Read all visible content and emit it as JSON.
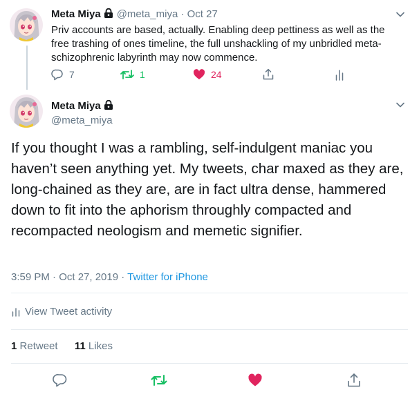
{
  "parent_tweet": {
    "name": "Meta Miya",
    "handle": "@meta_miya",
    "separator": "·",
    "date": "Oct 27",
    "text": "Priv accounts are based, actually. Enabling deep pettiness as well as the free trashing of ones timeline, the full unshackling of my unbridled meta-schizophrenic labyrinth may now commence.",
    "replies": "7",
    "retweets": "1",
    "likes": "24"
  },
  "main_tweet": {
    "name": "Meta Miya",
    "handle": "@meta_miya",
    "text": "If you thought I was a rambling, self-indulgent maniac you haven’t seen anything yet. My tweets, char maxed as they are, long-chained as they are, are in fact ultra dense, hammered down to fit into the aphorism throughly compacted and recompacted neologism and memetic signifier.",
    "timestamp": "3:59 PM · Oct 27, 2019",
    "meta_separator": "·",
    "source": "Twitter for iPhone",
    "activity_label": "View Tweet activity",
    "retweet_count": "1",
    "retweet_label": "Retweet",
    "like_count": "11",
    "like_label": "Likes"
  },
  "colors": {
    "text": "#14171a",
    "secondary": "#657786",
    "link": "#1b95e0",
    "retweet": "#17bf63",
    "like": "#e0245e",
    "divider": "#e6ecf0"
  },
  "icons": [
    "reply-icon",
    "retweet-icon",
    "heart-icon",
    "share-icon",
    "analytics-icon",
    "lock-icon",
    "chevron-down-icon"
  ]
}
